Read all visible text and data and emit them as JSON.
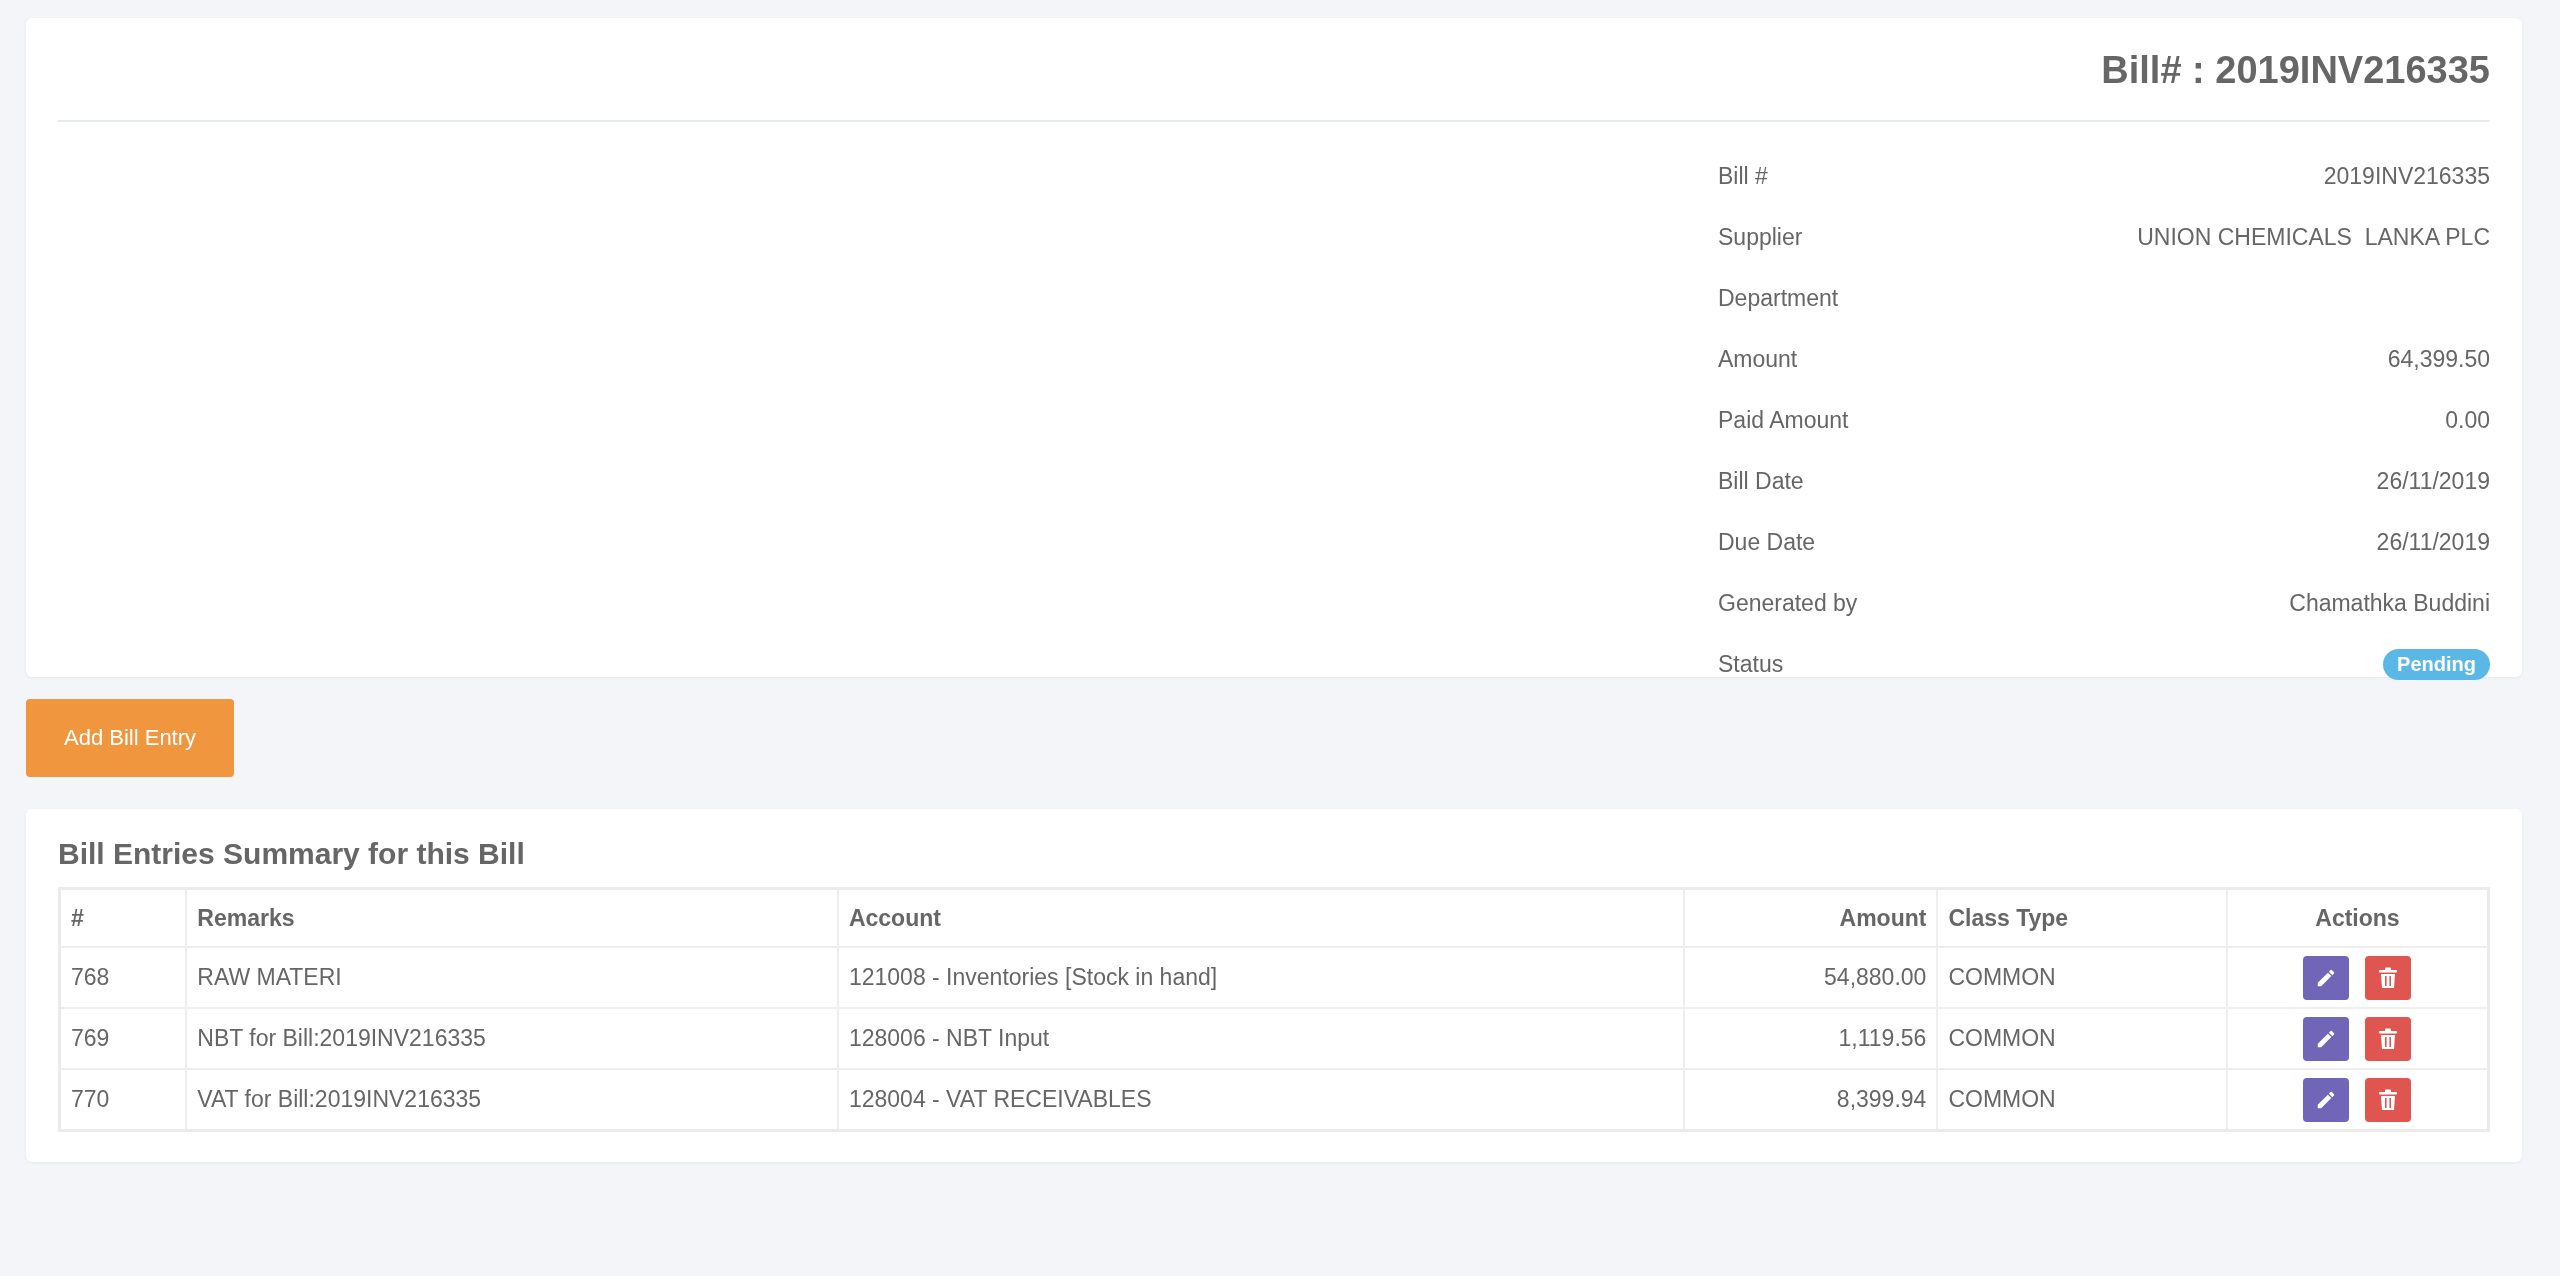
{
  "bill_card": {
    "title": "Bill# : 2019INV216335",
    "details": [
      {
        "label": "Bill #",
        "value": "2019INV216335"
      },
      {
        "label": "Supplier",
        "value": "UNION CHEMICALS  LANKA PLC"
      },
      {
        "label": "Department"
      },
      {
        "label": "Amount",
        "value": "64,399.50"
      },
      {
        "label": "Paid Amount",
        "value": "0.00"
      },
      {
        "label": "Bill Date",
        "value": "26/11/2019"
      },
      {
        "label": "Due Date",
        "value": "26/11/2019"
      },
      {
        "label": "Generated by",
        "value": "Chamathka Buddini"
      },
      {
        "label": "Status",
        "badge": "Pending",
        "color": "#5bb7e5"
      }
    ]
  },
  "add_button": "Add Bill Entry",
  "entries": {
    "title": "Bill Entries Summary for this Bill",
    "columns": [
      "#",
      "Remarks",
      "Account",
      "Amount",
      "Class Type",
      "Actions"
    ],
    "rows": [
      {
        "number": "768",
        "remarks": "RAW MATERI",
        "account": "121008 - Inventories [Stock in hand]",
        "amount": "54,880.00",
        "class_type": "COMMON"
      },
      {
        "number": "769",
        "remarks": "NBT for Bill:2019INV216335",
        "account": "128006 - NBT Input",
        "amount": "1,119.56",
        "class_type": "COMMON"
      },
      {
        "number": "770",
        "remarks": "VAT for Bill:2019INV216335",
        "account": "128004 - VAT RECEIVABLES",
        "amount": "8,399.94",
        "class_type": "COMMON"
      }
    ]
  }
}
